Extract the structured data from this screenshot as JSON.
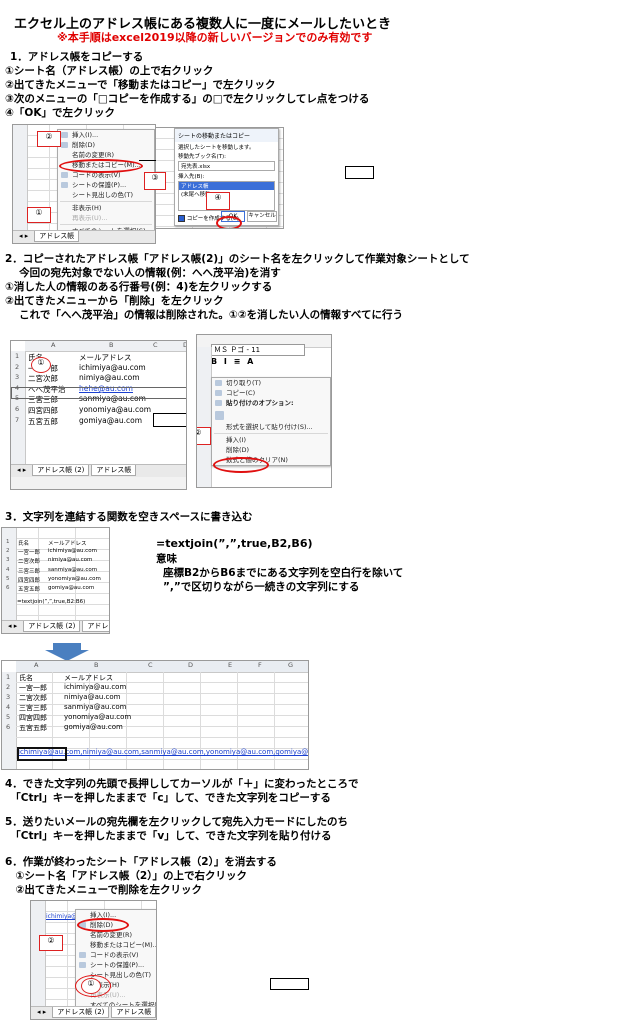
{
  "title": "エクセル上のアドレス帳にある複数人に一度にメールしたいとき",
  "note": "※本手順はexcel2019以降の新しいバージョンでのみ有効です",
  "step1": {
    "heading": "1．アドレス帳をコピーする",
    "lines": [
      "①シート名（アドレス帳）の上で右クリック",
      "②出てきたメニューで「移動またはコピー」で左クリック",
      "③次のメニューの「□コピーを作成する」の□で左クリックしてレ点をつける",
      "④「OK」で左クリック"
    ],
    "menu_items": [
      "挿入(I)...",
      "削除(D)",
      "名前の変更(R)",
      "移動またはコピー(M)...",
      "コードの表示(V)",
      "シートの保護(P)...",
      "シート見出しの色(T)",
      "非表示(H)",
      "再表示(U)...",
      "すべてのシートを選択(S)"
    ],
    "sheet_tab": "アドレス帳",
    "dialog_title": "シートの移動またはコピー",
    "dialog_lines": [
      "選択したシートを移動します。",
      "移動先ブック名(T):",
      "宛先表.xlsx",
      "挿入先(B):",
      "アドレス帳",
      "(末尾へ移動)"
    ],
    "dialog_checkbox": "コピーを作成する(C)",
    "dialog_ok": "OK",
    "dialog_cancel": "キャンセル",
    "callouts": [
      "①",
      "②",
      "③",
      "④"
    ]
  },
  "step2": {
    "lines": [
      "2．コピーされたアドレス帳「アドレス帳(2)」のシート名を左クリックして作業対象シートとして",
      "　 今回の宛先対象でない人の情報(例：へへ茂平治)を消す",
      "①消した人の情報のある行番号(例：4)を左クリックする",
      "②出てきたメニューから「削除」を左クリック",
      "　 これで「へへ茂平治」の情報は削除された。①②を消したい人の情報すべてに行う"
    ],
    "col_headers": [
      "A",
      "B",
      "C",
      "D"
    ],
    "rows": [
      {
        "num": "1",
        "name": "氏名",
        "mail": "メールアドレス"
      },
      {
        "num": "2",
        "name": "一宮一郎",
        "mail": "ichimiya@au.com"
      },
      {
        "num": "3",
        "name": "二宮次郎",
        "mail": "nimiya@au.com"
      },
      {
        "num": "4",
        "name": "へへ茂平治",
        "mail": "hehe@au.com"
      },
      {
        "num": "5",
        "name": "三宮三郎",
        "mail": "sanmiya@au.com"
      },
      {
        "num": "6",
        "name": "四宮四郎",
        "mail": "yonomiya@au.com"
      },
      {
        "num": "7",
        "name": "五宮五郎",
        "mail": "gomiya@au.com"
      }
    ],
    "sheet_tabs": [
      "アドレス帳 (2)",
      "アドレス帳"
    ],
    "font_box": "ＭＳ Ｐゴ - 11",
    "menu_items": [
      "切り取り(T)",
      "コピー(C)",
      "貼り付けのオプション:",
      "形式を選択して貼り付け(S)...",
      "挿入(I)",
      "削除(D)",
      "数式と値のクリア(N)"
    ],
    "callouts": [
      "①",
      "②"
    ]
  },
  "step3": {
    "heading": "3．文字列を連結する関数を空きスペースに書き込む",
    "formula": "=textjoin(”,”,true,B2,B6)",
    "meaning": "意味",
    "desc1": "座標B2からB6までにある文字列を空白行を除いて",
    "desc2": "”,”で区切りながら一続きの文字列にする",
    "small_rows": [
      {
        "num": "1",
        "name": "氏名",
        "mail": "メールアドレス"
      },
      {
        "num": "2",
        "name": "一宮一郎",
        "mail": "ichimiya@au.com"
      },
      {
        "num": "3",
        "name": "二宮次郎",
        "mail": "nimiya@au.com"
      },
      {
        "num": "4",
        "name": "三宮三郎",
        "mail": "sanmiya@au.com"
      },
      {
        "num": "5",
        "name": "四宮四郎",
        "mail": "yonomiya@au.com"
      },
      {
        "num": "6",
        "name": "五宮五郎",
        "mail": "gomiya@au.com"
      }
    ],
    "small_formula_cell": "=textjoin(”,”,true,B2:B6)",
    "sheet_tabs": [
      "アドレス帳 (2)",
      "アドレス帳"
    ],
    "result_col_headers": [
      "A",
      "B",
      "C",
      "D",
      "E",
      "F",
      "G"
    ],
    "result_text": "ichimiya@au.com,nimiya@au.com,sanmiya@au.com,yonomiya@au.com,gomiya@au.com"
  },
  "step4": {
    "lines": [
      "4．できた文字列の先頭で長押ししてカーソルが「＋」に変わったところで",
      "　「Ctrl」キーを押したままで「c」して、できた文字列をコピーする"
    ]
  },
  "step5": {
    "lines": [
      "5．送りたいメールの宛先欄を左クリックして宛先入力モードにしたのち",
      "　「Ctrl」キーを押したままで「v」して、できた文字列を貼り付ける"
    ]
  },
  "step6": {
    "lines": [
      "6．作業が終わったシート「アドレス帳（2）」を消去する",
      "　①シート名「アドレス帳（2）」の上で右クリック",
      "　②出てきたメニューで削除を左クリック"
    ],
    "cell_text": "ichimiya@au.c",
    "menu_items": [
      "挿入(I)...",
      "削除(D)",
      "名前の変更(R)",
      "移動またはコピー(M)...",
      "コードの表示(V)",
      "シートの保護(P)...",
      "シート見出しの色(T)",
      "非表示(H)",
      "再表示(U)...",
      "すべてのシートを選択(S)"
    ],
    "sheet_tabs": [
      "アドレス帳 (2)",
      "アドレス帳"
    ],
    "callouts": [
      "①",
      "②"
    ]
  }
}
